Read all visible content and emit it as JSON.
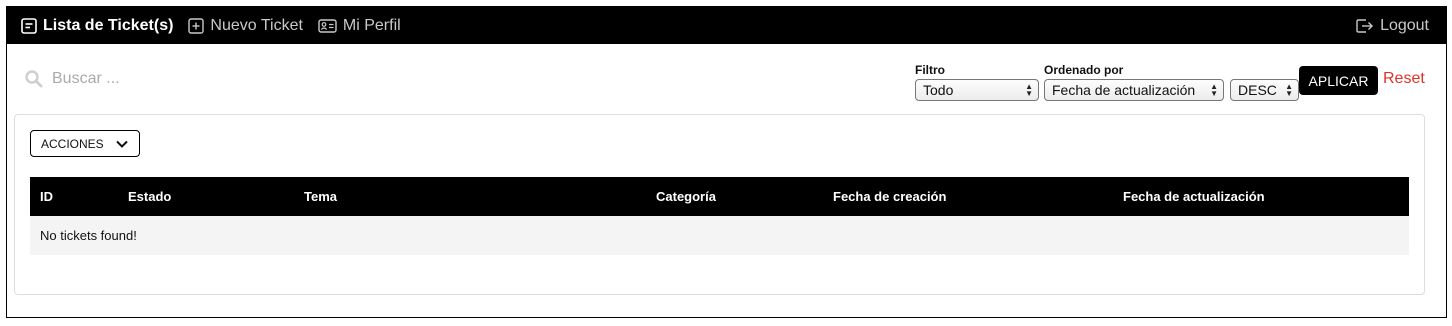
{
  "nav": {
    "items": [
      {
        "label": "Lista de Ticket(s)",
        "icon": "list-box-icon"
      },
      {
        "label": "Nuevo Ticket",
        "icon": "plus-box-icon"
      },
      {
        "label": "Mi Perfil",
        "icon": "id-card-icon"
      }
    ],
    "logout_label": "Logout"
  },
  "search": {
    "placeholder": "Buscar ...",
    "value": ""
  },
  "filter": {
    "label": "Filtro",
    "selected": "Todo"
  },
  "order": {
    "label": "Ordenado por",
    "selected": "Fecha de actualización",
    "direction": "DESC"
  },
  "apply_label": "APLICAR",
  "reset_label": "Reset",
  "actions_label": "ACCIONES",
  "table": {
    "columns": [
      "ID",
      "Estado",
      "Tema",
      "Categoría",
      "Fecha de creación",
      "Fecha de actualización"
    ],
    "empty_message": "No tickets found!"
  },
  "colors": {
    "navbar": "#000000",
    "reset": "#e0322b",
    "row_bg": "#f4f4f4"
  }
}
